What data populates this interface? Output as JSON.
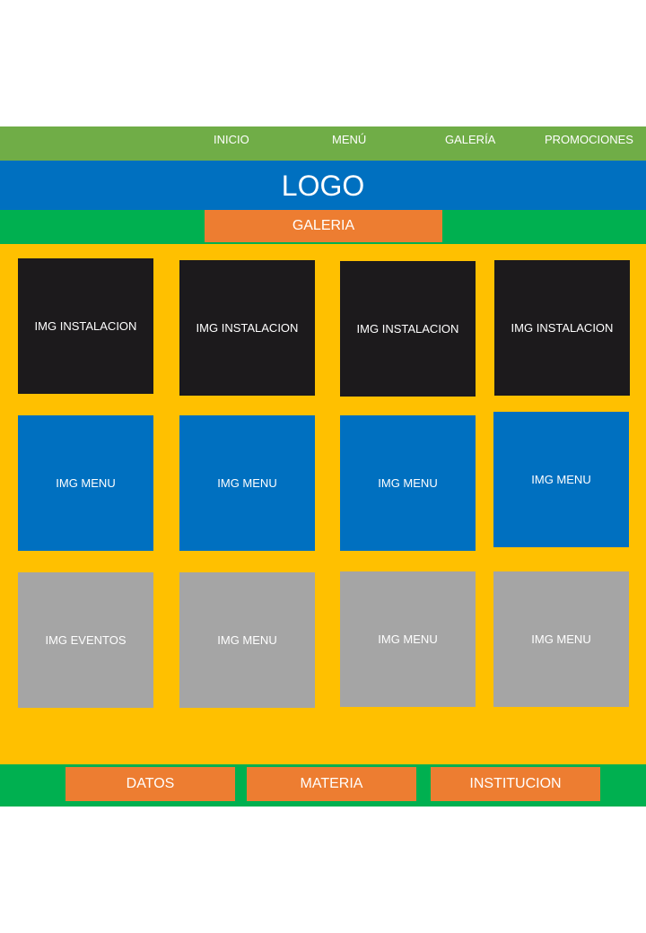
{
  "nav": {
    "items": [
      {
        "label": "INICIO"
      },
      {
        "label": "MENÚ"
      },
      {
        "label": "GALERÍA"
      },
      {
        "label": "PROMOCIONES"
      }
    ]
  },
  "header": {
    "logo": "LOGO"
  },
  "section": {
    "title": "GALERIA"
  },
  "gallery": {
    "rows": [
      {
        "tiles": [
          "IMG INSTALACION",
          "IMG INSTALACION",
          "IMG INSTALACION",
          "IMG INSTALACION"
        ],
        "color": "#1C1A1C"
      },
      {
        "tiles": [
          "IMG MENU",
          "IMG MENU",
          "IMG MENU",
          "IMG MENU"
        ],
        "color": "#0070C0"
      },
      {
        "tiles": [
          "IMG EVENTOS",
          "IMG MENU",
          "IMG MENU",
          "IMG MENU"
        ],
        "color": "#A5A5A5"
      }
    ]
  },
  "footer": {
    "buttons": [
      {
        "label": "DATOS"
      },
      {
        "label": "MATERIA"
      },
      {
        "label": "INSTITUCION"
      }
    ]
  },
  "colors": {
    "nav_bg": "#70AD47",
    "logo_bg": "#0070C0",
    "green_bar": "#00B050",
    "orange": "#ED7D31",
    "gallery_bg": "#FFC000"
  }
}
